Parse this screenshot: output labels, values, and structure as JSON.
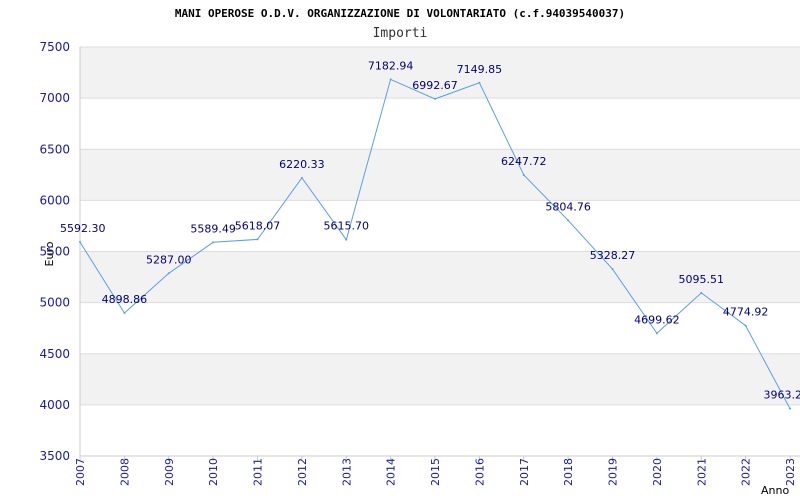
{
  "chart_data": {
    "type": "line",
    "title": "MANI OPEROSE O.D.V. ORGANIZZAZIONE DI VOLONTARIATO (c.f.94039540037)",
    "subtitle": "Importi",
    "xlabel": "Anno",
    "ylabel": "Euro",
    "ylim": [
      3500,
      7500
    ],
    "yticks": [
      3500,
      4000,
      4500,
      5000,
      5500,
      6000,
      6500,
      7000,
      7500
    ],
    "categories": [
      "2007",
      "2008",
      "2009",
      "2010",
      "2011",
      "2012",
      "2013",
      "2014",
      "2015",
      "2016",
      "2017",
      "2018",
      "2019",
      "2020",
      "2021",
      "2022",
      "2023"
    ],
    "values": [
      5592.3,
      4898.86,
      5287.0,
      5589.49,
      5618.07,
      6220.33,
      5615.7,
      7182.94,
      6992.67,
      7149.85,
      6247.72,
      5804.76,
      5328.27,
      4699.62,
      5095.51,
      4774.92,
      3963.2
    ],
    "value_labels": [
      "5592.30",
      "4898.86",
      "5287.00",
      "5589.49",
      "5618.07",
      "6220.33",
      "5615.70",
      "7182.94",
      "6992.67",
      "7149.85",
      "6247.72",
      "5804.76",
      "5328.27",
      "4699.62",
      "5095.51",
      "4774.92",
      "3963.2"
    ],
    "grid": true,
    "legend": "none",
    "colors": {
      "line": "#5aa0e6",
      "band": "#f2f2f2",
      "grid": "#dddddd",
      "axis": "#cccccc",
      "tick_text": "#1a1aa6",
      "label_text": "#000080"
    }
  }
}
